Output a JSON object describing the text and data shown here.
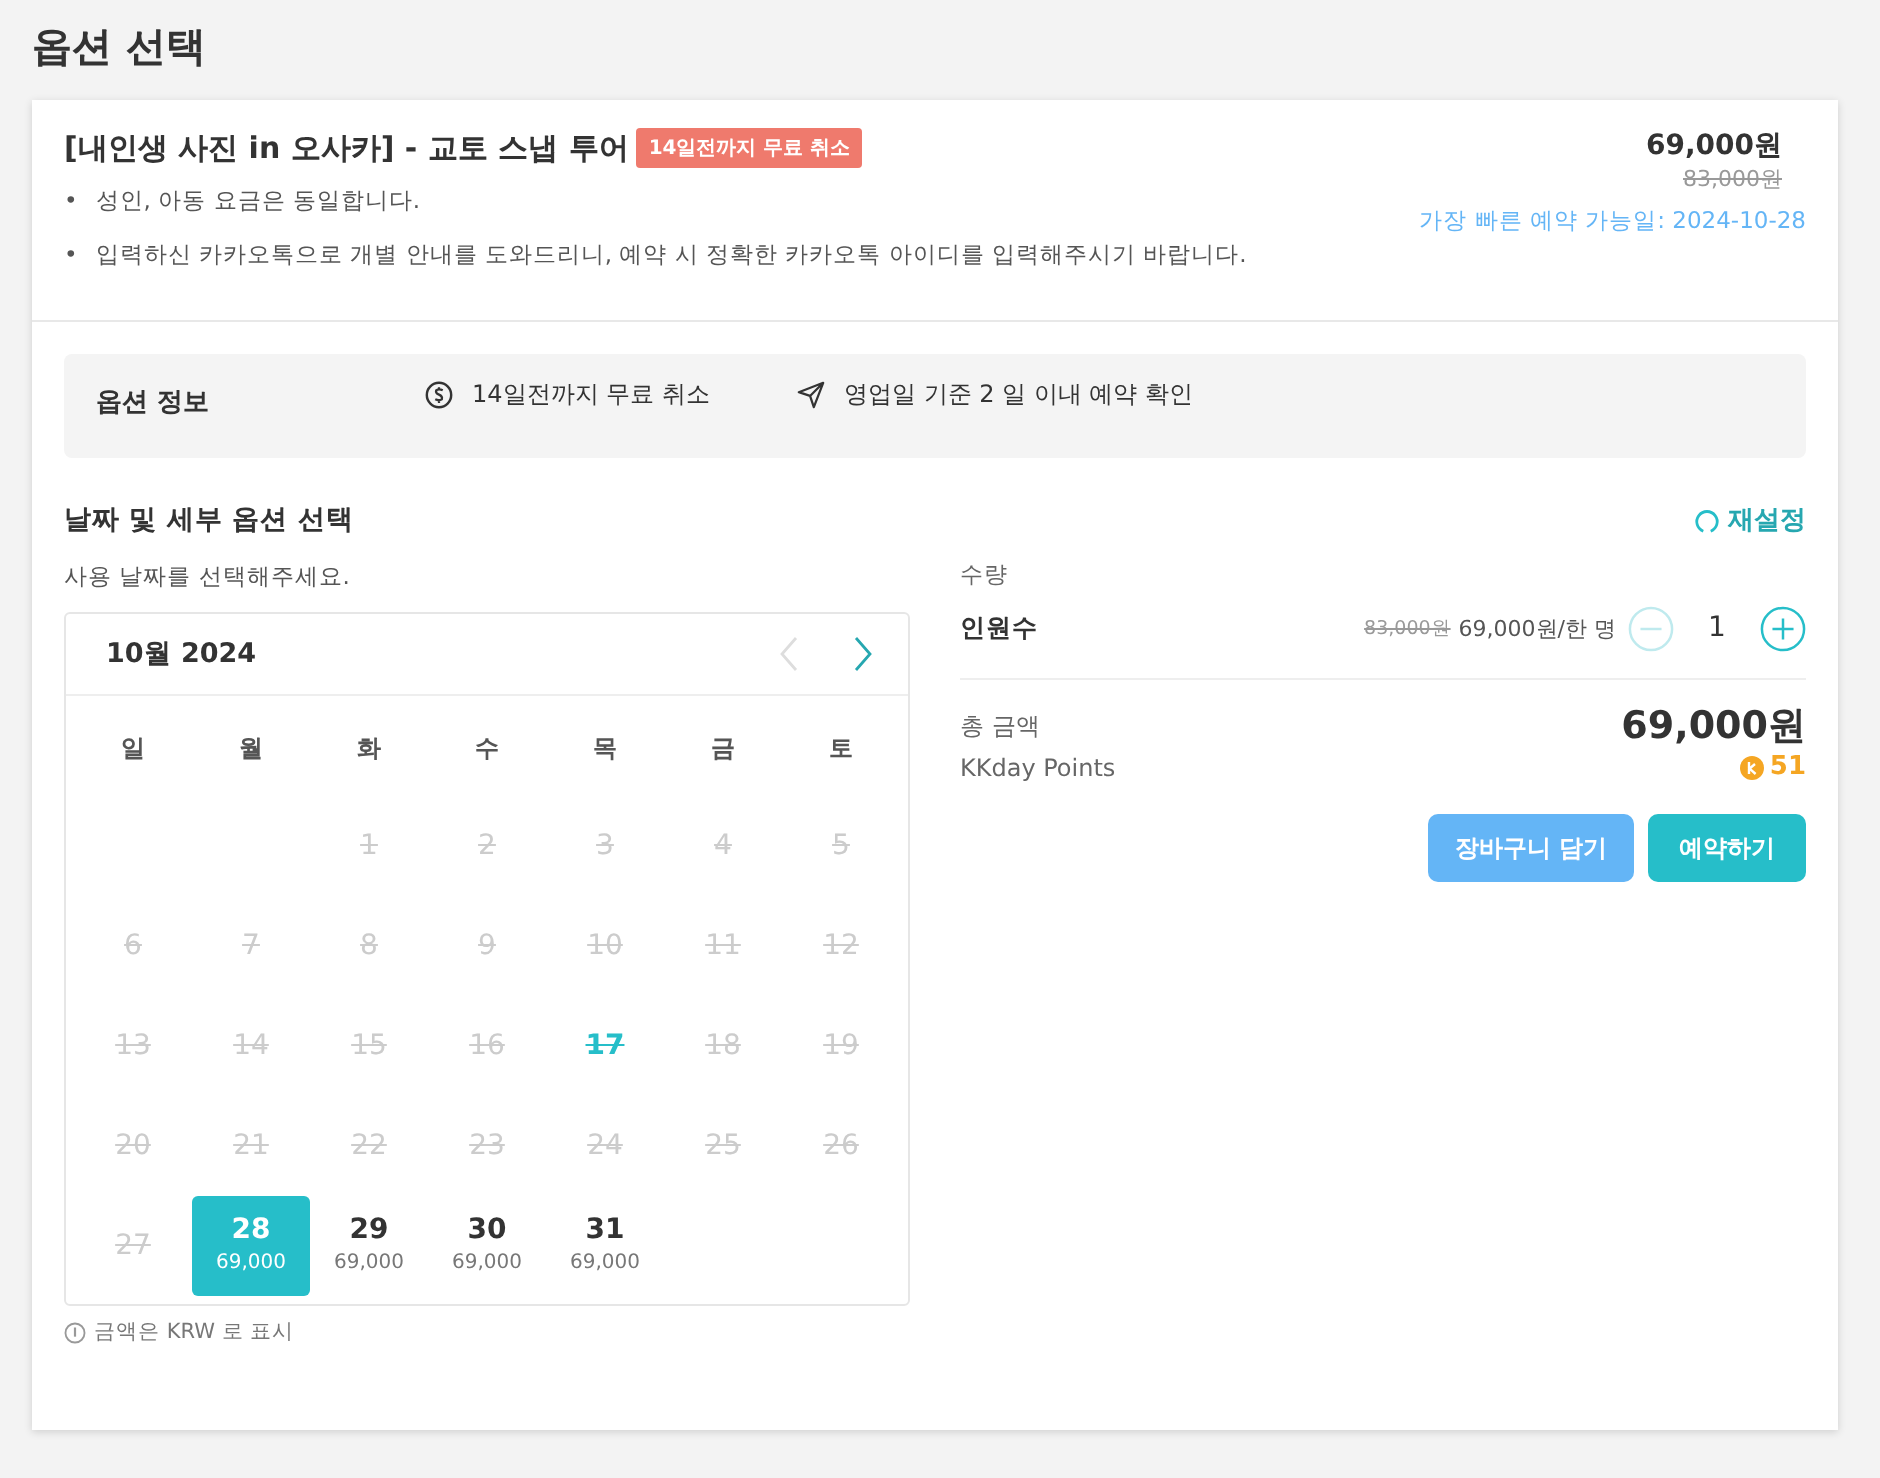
{
  "page_title": "옵션 선택",
  "product": {
    "title": "[내인생 사진 in 오사카] - 교토 스냅 투어",
    "badge": "14일전까지 무료 취소",
    "notes": [
      {
        "bullet": "•",
        "text": "성인, 아동 요금은 동일합니다."
      },
      {
        "bullet": "•",
        "text": "입력하신 카카오톡으로 개별 안내를 도와드리니, 예약 시 정확한 카카오톡 아이디를 입력해주시기 바랍니다."
      }
    ],
    "price": "69,000원",
    "original_price": "83,000원",
    "earliest_date": "가장 빠른 예약 가능일: 2024-10-28"
  },
  "option_info": {
    "label": "옵션 정보",
    "items": [
      {
        "kind": "refund",
        "text": "14일전까지 무료 취소"
      },
      {
        "kind": "confirm",
        "text": "영업일 기준 2 일 이내 예약 확인"
      }
    ]
  },
  "section_title": "날짜 및 세부 옵션 선택",
  "reset": "재설정",
  "calendar": {
    "hint": "사용 날짜를 선택해주세요.",
    "month": "10월 2024",
    "prev_disabled": true,
    "next_disabled": false,
    "weekdays": [
      "일",
      "월",
      "화",
      "수",
      "목",
      "금",
      "토"
    ],
    "days": [
      {
        "kind": "empty"
      },
      {
        "kind": "empty"
      },
      {
        "kind": "day",
        "day": "1",
        "disabled": true,
        "today": false,
        "selected": false
      },
      {
        "kind": "day",
        "day": "2",
        "disabled": true,
        "today": false,
        "selected": false
      },
      {
        "kind": "day",
        "day": "3",
        "disabled": true,
        "today": false,
        "selected": false
      },
      {
        "kind": "day",
        "day": "4",
        "disabled": true,
        "today": false,
        "selected": false
      },
      {
        "kind": "day",
        "day": "5",
        "disabled": true,
        "today": false,
        "selected": false
      },
      {
        "kind": "day",
        "day": "6",
        "disabled": true,
        "today": false,
        "selected": false
      },
      {
        "kind": "day",
        "day": "7",
        "disabled": true,
        "today": false,
        "selected": false
      },
      {
        "kind": "day",
        "day": "8",
        "disabled": true,
        "today": false,
        "selected": false
      },
      {
        "kind": "day",
        "day": "9",
        "disabled": true,
        "today": false,
        "selected": false
      },
      {
        "kind": "day",
        "day": "10",
        "disabled": true,
        "today": false,
        "selected": false
      },
      {
        "kind": "day",
        "day": "11",
        "disabled": true,
        "today": false,
        "selected": false
      },
      {
        "kind": "day",
        "day": "12",
        "disabled": true,
        "today": false,
        "selected": false
      },
      {
        "kind": "day",
        "day": "13",
        "disabled": true,
        "today": false,
        "selected": false
      },
      {
        "kind": "day",
        "day": "14",
        "disabled": true,
        "today": false,
        "selected": false
      },
      {
        "kind": "day",
        "day": "15",
        "disabled": true,
        "today": false,
        "selected": false
      },
      {
        "kind": "day",
        "day": "16",
        "disabled": true,
        "today": false,
        "selected": false
      },
      {
        "kind": "day",
        "day": "17",
        "disabled": true,
        "today": true,
        "selected": false
      },
      {
        "kind": "day",
        "day": "18",
        "disabled": true,
        "today": false,
        "selected": false
      },
      {
        "kind": "day",
        "day": "19",
        "disabled": true,
        "today": false,
        "selected": false
      },
      {
        "kind": "day",
        "day": "20",
        "disabled": true,
        "today": false,
        "selected": false
      },
      {
        "kind": "day",
        "day": "21",
        "disabled": true,
        "today": false,
        "selected": false
      },
      {
        "kind": "day",
        "day": "22",
        "disabled": true,
        "today": false,
        "selected": false
      },
      {
        "kind": "day",
        "day": "23",
        "disabled": true,
        "today": false,
        "selected": false
      },
      {
        "kind": "day",
        "day": "24",
        "disabled": true,
        "today": false,
        "selected": false
      },
      {
        "kind": "day",
        "day": "25",
        "disabled": true,
        "today": false,
        "selected": false
      },
      {
        "kind": "day",
        "day": "26",
        "disabled": true,
        "today": false,
        "selected": false
      },
      {
        "kind": "day",
        "day": "27",
        "disabled": true,
        "today": false,
        "selected": false
      },
      {
        "kind": "day",
        "day": "28",
        "disabled": false,
        "today": false,
        "selected": true,
        "price": "69,000"
      },
      {
        "kind": "day",
        "day": "29",
        "disabled": false,
        "today": false,
        "selected": false,
        "price": "69,000"
      },
      {
        "kind": "day",
        "day": "30",
        "disabled": false,
        "today": false,
        "selected": false,
        "price": "69,000"
      },
      {
        "kind": "day",
        "day": "31",
        "disabled": false,
        "today": false,
        "selected": false,
        "price": "69,000"
      }
    ],
    "currency_note": "금액은 KRW 로 표시"
  },
  "quantity": {
    "label": "수량",
    "name": "인원수",
    "original_price": "83,000원",
    "unit_price": "69,000원/한 명",
    "value": "1",
    "minus_disabled": true,
    "plus_disabled": false
  },
  "total": {
    "label": "총 금액",
    "amount": "69,000원",
    "points_label": "KKday Points",
    "points": "51"
  },
  "buttons": [
    {
      "kind": "cart",
      "label": "장바구니 담기"
    },
    {
      "kind": "book",
      "label": "예약하기"
    }
  ]
}
